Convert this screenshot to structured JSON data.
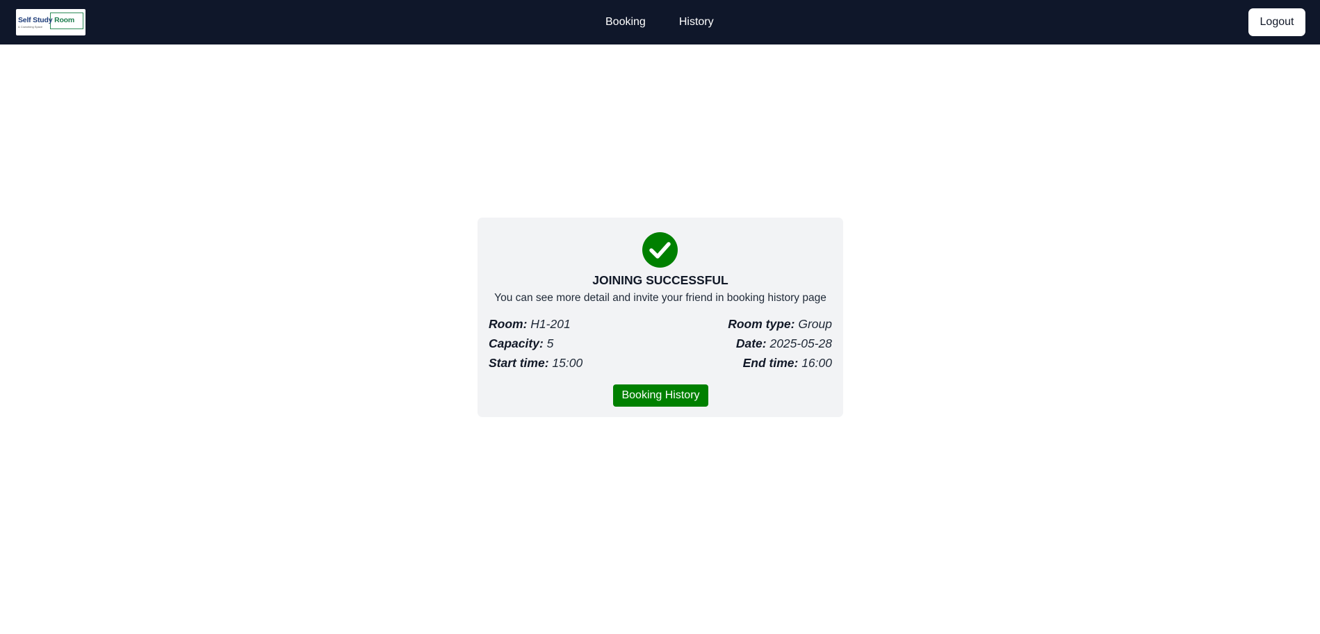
{
  "nav": {
    "logo": {
      "text_main": "Self Study",
      "text_room": "Room",
      "text_sub": "& Coworking Space"
    },
    "links": [
      "Booking",
      "History"
    ],
    "logout_label": "Logout"
  },
  "confirmation": {
    "icon": "check-circle-icon",
    "icon_color": "#008000",
    "title": "JOINING SUCCESSFUL",
    "subtitle": "You can see more detail and invite your friend in booking history page",
    "details": {
      "room_label": "Room:",
      "room_value": "H1-201",
      "room_type_label": "Room type:",
      "room_type_value": "Group",
      "capacity_label": "Capacity:",
      "capacity_value": "5",
      "date_label": "Date:",
      "date_value": "2025-05-28",
      "start_time_label": "Start time:",
      "start_time_value": "15:00",
      "end_time_label": "End time:",
      "end_time_value": "16:00"
    },
    "button_label": "Booking History",
    "button_color": "#008000"
  },
  "colors": {
    "navbar_bg": "#0f172a",
    "card_bg": "#f2f3f5"
  }
}
